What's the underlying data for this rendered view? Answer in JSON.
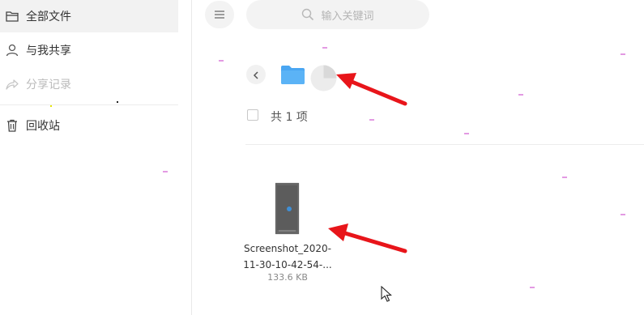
{
  "sidebar": {
    "items": [
      {
        "label": "全部文件",
        "icon": "folder-outline-icon",
        "active": true
      },
      {
        "label": "与我共享",
        "icon": "user-icon",
        "active": false
      },
      {
        "label": "分享记录",
        "icon": "share-icon",
        "active": false,
        "disabled": true
      },
      {
        "label": "回收站",
        "icon": "trash-icon",
        "active": false
      }
    ]
  },
  "toolbar": {
    "menu_icon": "menu-icon",
    "search_placeholder": "输入关键词"
  },
  "breadcrumb": {
    "back_icon": "chevron-left-icon",
    "folder_icon": "folder-icon",
    "loading_icon": "loading-icon"
  },
  "content": {
    "count_text": "共 1 项",
    "files": [
      {
        "name_line1": "Screenshot_2020-",
        "name_line2": "11-30-10-42-54-...",
        "size": "133.6 KB"
      }
    ]
  },
  "colors": {
    "accent": "#4aa6f2",
    "annotation_arrow": "#e8151a",
    "sidebar_active_bg": "#f2f2f2"
  }
}
